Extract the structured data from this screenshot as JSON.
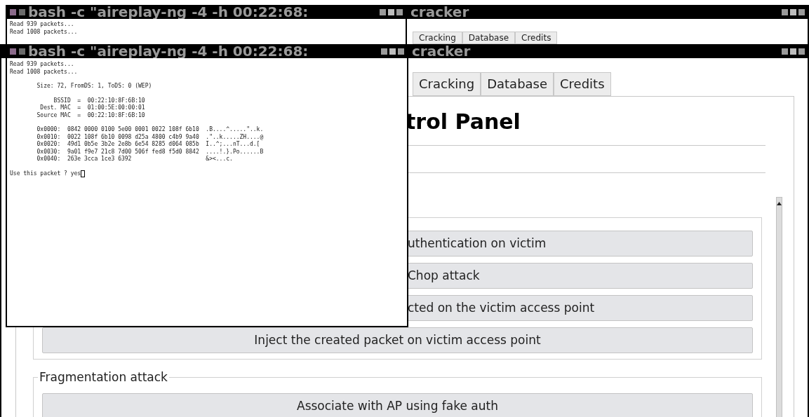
{
  "back_layer": {
    "terminal": {
      "title": "bash -c \"aireplay-ng -4 -h 00:22:68:",
      "lines": [
        "Read 939 packets...",
        "Read 1008 packets..."
      ]
    },
    "cracker": {
      "title": "cracker",
      "tabs": [
        "Cracking",
        "Database",
        "Credits"
      ]
    }
  },
  "front_layer": {
    "terminal": {
      "title": "bash -c \"aireplay-ng -4 -h 00:22:68:",
      "blocks": [
        [
          "Read 939 packets...",
          "Read 1008 packets..."
        ],
        [
          "        Size: 72, FromDS: 1, ToDS: 0 (WEP)"
        ],
        [
          "             BSSID  =  00:22:10:8F:6B:10",
          "         Dest. MAC  =  01:00:5E:00:00:01",
          "        Source MAC  =  00:22:10:8F:6B:10"
        ],
        [
          "        0x0000:  0842 0000 0100 5e00 0001 0022 108f 6b10  .B....^.....\"..k.",
          "        0x0010:  0022 108f 6b10 0098 d25a 4800 c4b9 9a40  .\"..k.....ZH....@",
          "        0x0020:  49d1 0b5e 3b2e 2e8b 6e54 8285 d064 085b  I..^;...nT...d.[",
          "        0x0030:  9a01 f9e7 21c8 7d00 506f fed8 f5d0 8842  ....!.}.Po......B",
          "        0x0040:  263e 3cca 1ce3 6392                      &><...c."
        ],
        [
          "Use this packet ? yes"
        ]
      ]
    },
    "cracker": {
      "title": "cracker",
      "tabs": [
        "Cracking",
        "Database",
        "Credits"
      ],
      "heading": "trol Panel",
      "buttons": [
        {
          "label": "uthentication on victim",
          "kind": "clipped"
        },
        {
          "label": "Chop attack",
          "kind": "clipped"
        },
        {
          "label": "cted on the victim access point",
          "kind": "clipped"
        },
        {
          "label": "Inject the created packet on victim access point",
          "kind": "full"
        }
      ],
      "fragmentation_attack": {
        "legend": "Fragmentation attack",
        "buttons": [
          "Associate with AP using fake auth"
        ]
      }
    }
  }
}
